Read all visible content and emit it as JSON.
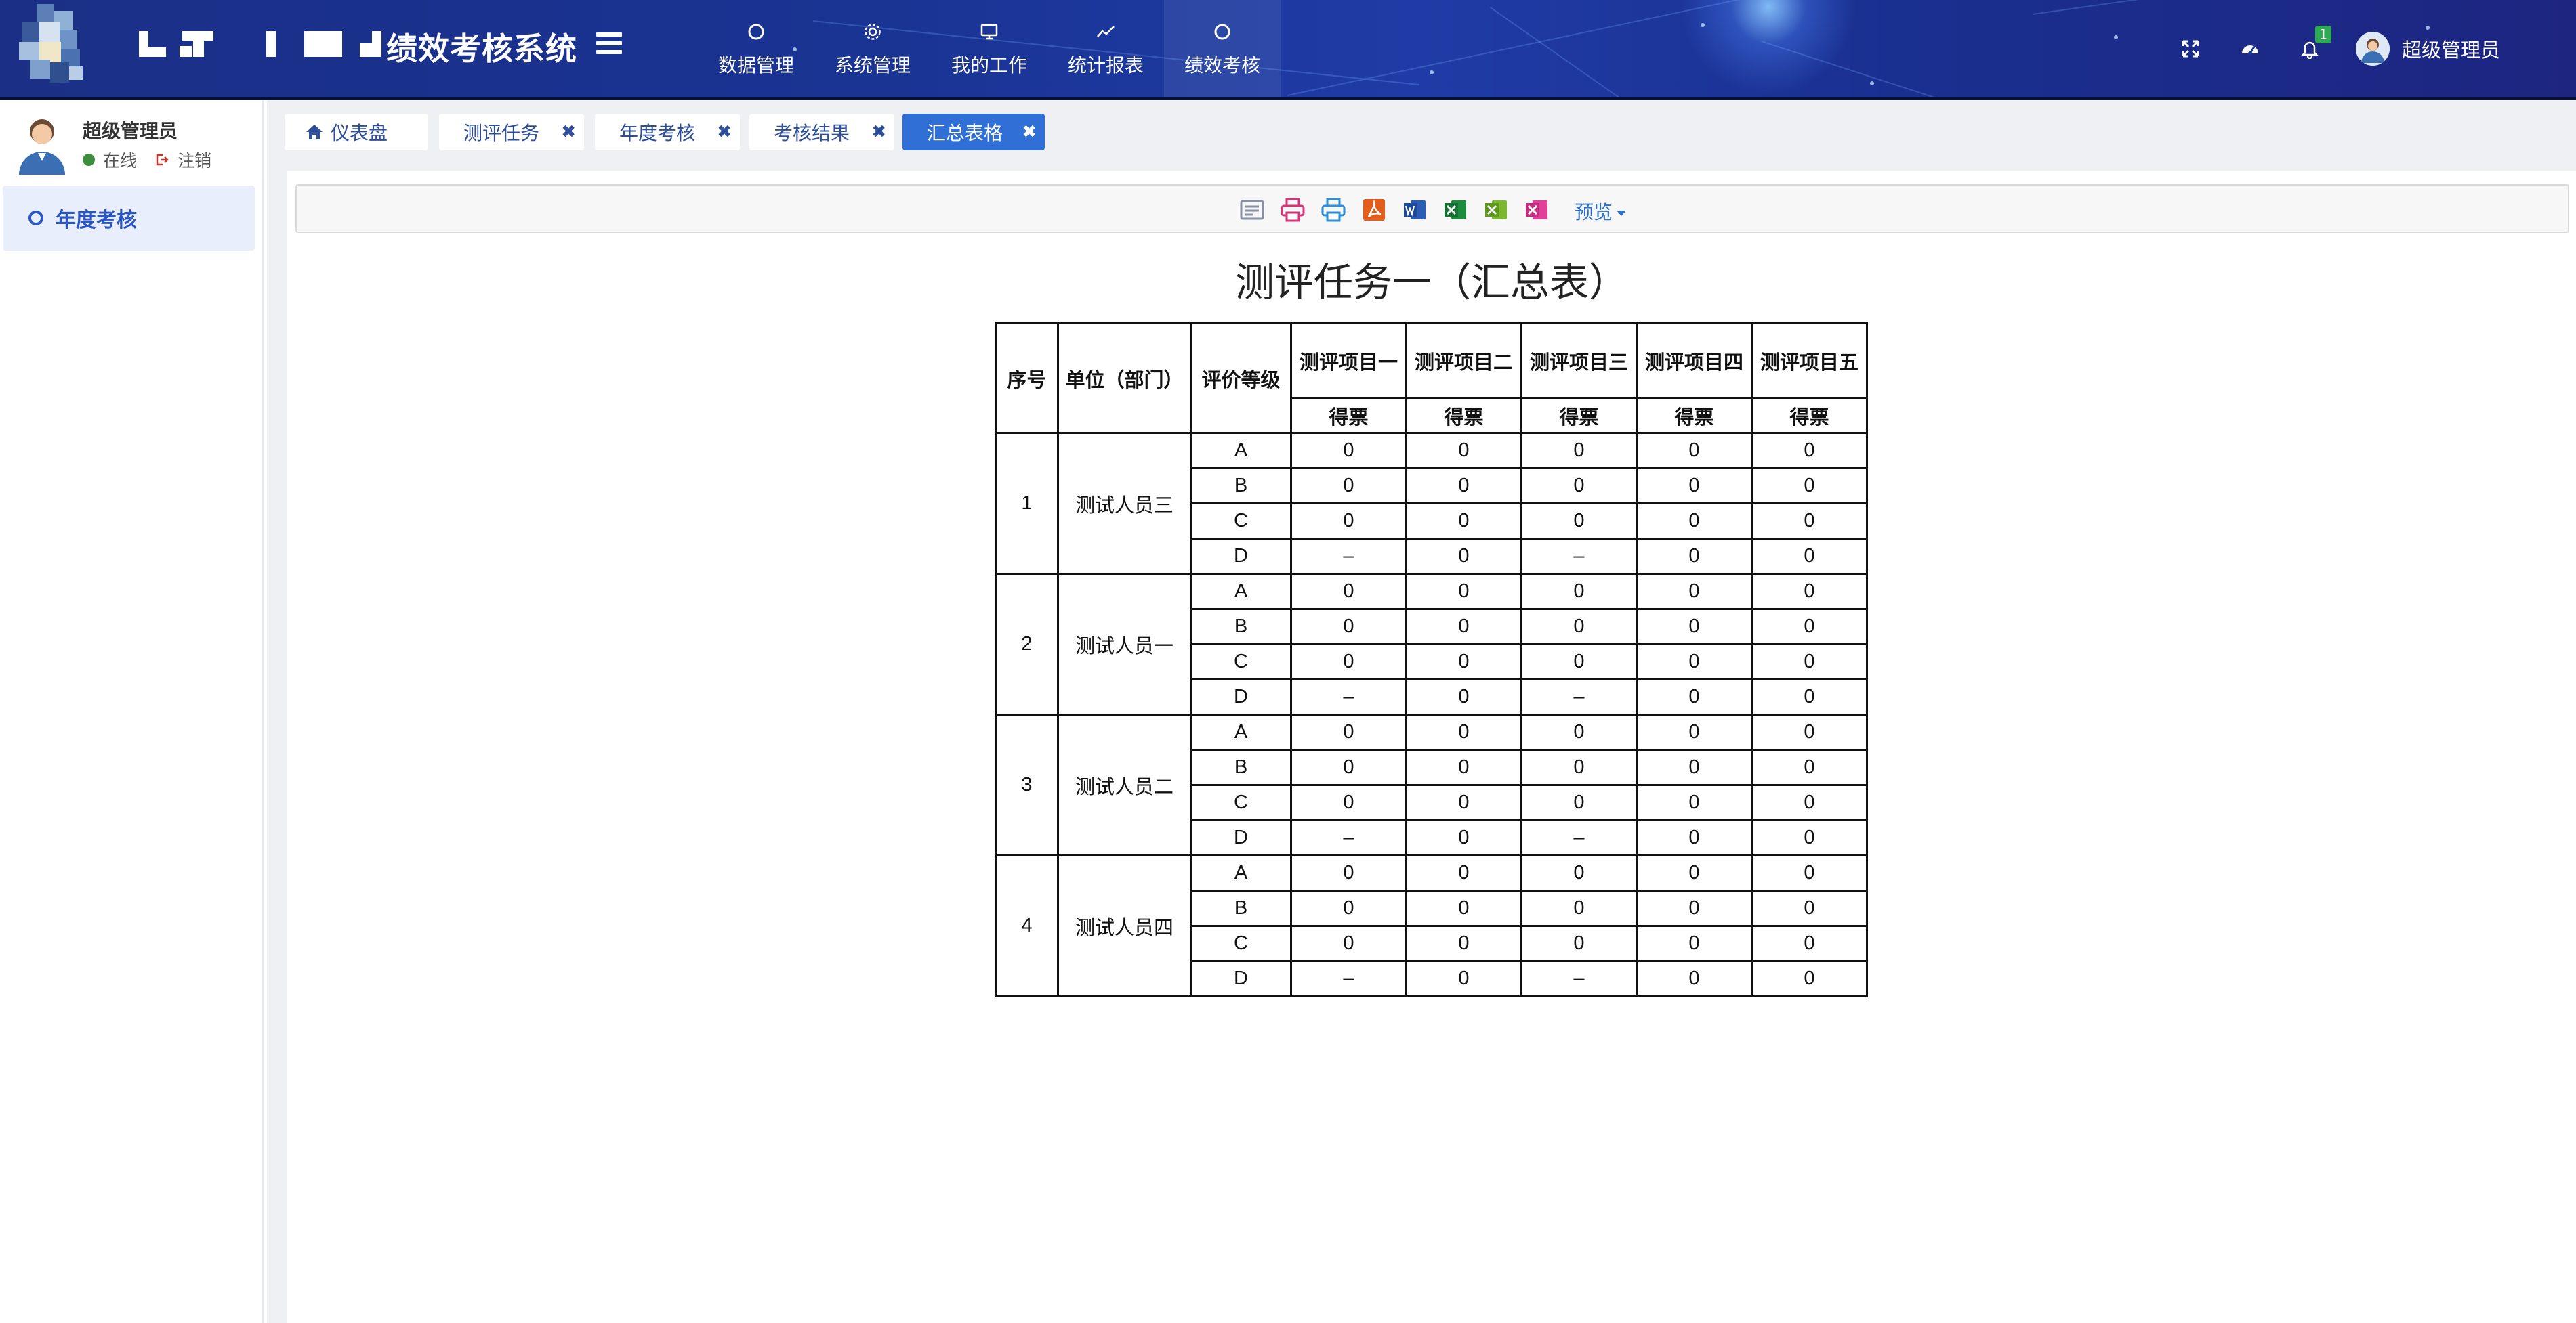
{
  "app": {
    "title": "绩效考核系统"
  },
  "nav": {
    "items": [
      {
        "label": "数据管理",
        "icon": "circle-icon"
      },
      {
        "label": "系统管理",
        "icon": "gear-icon"
      },
      {
        "label": "我的工作",
        "icon": "monitor-icon"
      },
      {
        "label": "统计报表",
        "icon": "line-chart-icon"
      },
      {
        "label": "绩效考核",
        "icon": "circle-icon"
      }
    ],
    "active": "绩效考核"
  },
  "header_right": {
    "notification_count": "1",
    "username": "超级管理员"
  },
  "sidebar": {
    "user_name": "超级管理员",
    "status_online": "在线",
    "logout": "注销",
    "menu_item": "年度考核"
  },
  "tabs": [
    {
      "label": "仪表盘",
      "closable": false
    },
    {
      "label": "测评任务",
      "closable": true
    },
    {
      "label": "年度考核",
      "closable": true
    },
    {
      "label": "考核结果",
      "closable": true
    },
    {
      "label": "汇总表格",
      "closable": true,
      "active": true
    }
  ],
  "tab_close_glyph": "✖",
  "toolbar": {
    "icons": [
      "design-icon",
      "print-icon",
      "print-preview-icon",
      "pdf-icon",
      "word-icon",
      "excel-icon",
      "excel-alt-icon",
      "excel-pink-icon"
    ],
    "preview_label": "预览"
  },
  "report": {
    "title": "测评任务一（汇总表）",
    "headers": {
      "no": "序号",
      "unit": "单位（部门）",
      "grade": "评价等级",
      "items": [
        "测评项目一",
        "测评项目二",
        "测评项目三",
        "测评项目四",
        "测评项目五"
      ],
      "sub": "得票"
    },
    "rows": [
      {
        "no": "1",
        "unit": "测试人员三",
        "grades": [
          {
            "g": "A",
            "v": [
              "0",
              "0",
              "0",
              "0",
              "0"
            ]
          },
          {
            "g": "B",
            "v": [
              "0",
              "0",
              "0",
              "0",
              "0"
            ]
          },
          {
            "g": "C",
            "v": [
              "0",
              "0",
              "0",
              "0",
              "0"
            ]
          },
          {
            "g": "D",
            "v": [
              "–",
              "0",
              "–",
              "0",
              "0"
            ]
          }
        ]
      },
      {
        "no": "2",
        "unit": "测试人员一",
        "grades": [
          {
            "g": "A",
            "v": [
              "0",
              "0",
              "0",
              "0",
              "0"
            ]
          },
          {
            "g": "B",
            "v": [
              "0",
              "0",
              "0",
              "0",
              "0"
            ]
          },
          {
            "g": "C",
            "v": [
              "0",
              "0",
              "0",
              "0",
              "0"
            ]
          },
          {
            "g": "D",
            "v": [
              "–",
              "0",
              "–",
              "0",
              "0"
            ]
          }
        ]
      },
      {
        "no": "3",
        "unit": "测试人员二",
        "grades": [
          {
            "g": "A",
            "v": [
              "0",
              "0",
              "0",
              "0",
              "0"
            ]
          },
          {
            "g": "B",
            "v": [
              "0",
              "0",
              "0",
              "0",
              "0"
            ]
          },
          {
            "g": "C",
            "v": [
              "0",
              "0",
              "0",
              "0",
              "0"
            ]
          },
          {
            "g": "D",
            "v": [
              "–",
              "0",
              "–",
              "0",
              "0"
            ]
          }
        ]
      },
      {
        "no": "4",
        "unit": "测试人员四",
        "grades": [
          {
            "g": "A",
            "v": [
              "0",
              "0",
              "0",
              "0",
              "0"
            ]
          },
          {
            "g": "B",
            "v": [
              "0",
              "0",
              "0",
              "0",
              "0"
            ]
          },
          {
            "g": "C",
            "v": [
              "0",
              "0",
              "0",
              "0",
              "0"
            ]
          },
          {
            "g": "D",
            "v": [
              "–",
              "0",
              "–",
              "0",
              "0"
            ]
          }
        ]
      }
    ]
  },
  "colors": {
    "topbar": "#1a3494",
    "accent": "#2f6fd6",
    "sidebar_active_bg": "#e8eefb",
    "sidebar_active_text": "#2a56c6",
    "online": "#3d8f3d",
    "badge": "#2eab52"
  }
}
